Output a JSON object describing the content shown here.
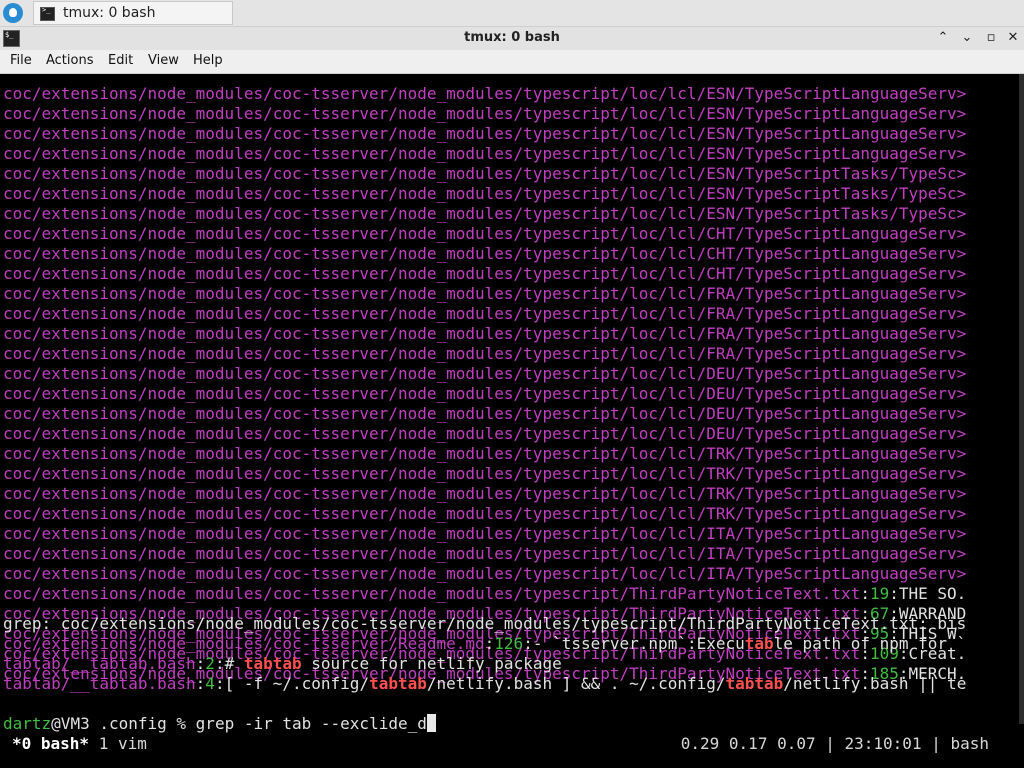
{
  "taskbar": {
    "task_label": "tmux: 0 bash"
  },
  "window": {
    "title": "tmux: 0 bash",
    "controls": {
      "collapse": "⌃",
      "minimize": "⌄",
      "maximize": "▫",
      "close": "✕"
    }
  },
  "menubar": {
    "items": [
      "File",
      "Actions",
      "Edit",
      "View",
      "Help"
    ]
  },
  "terminal": {
    "results": [
      {
        "path": "coc/extensions/node_modules/coc-tsserver/node_modules/typescript/loc/lcl/ESN/TypeScriptLanguageServ>"
      },
      {
        "path": "coc/extensions/node_modules/coc-tsserver/node_modules/typescript/loc/lcl/ESN/TypeScriptLanguageServ>"
      },
      {
        "path": "coc/extensions/node_modules/coc-tsserver/node_modules/typescript/loc/lcl/ESN/TypeScriptLanguageServ>"
      },
      {
        "path": "coc/extensions/node_modules/coc-tsserver/node_modules/typescript/loc/lcl/ESN/TypeScriptLanguageServ>"
      },
      {
        "path": "coc/extensions/node_modules/coc-tsserver/node_modules/typescript/loc/lcl/ESN/TypeScriptTasks/TypeSc>"
      },
      {
        "path": "coc/extensions/node_modules/coc-tsserver/node_modules/typescript/loc/lcl/ESN/TypeScriptTasks/TypeSc>"
      },
      {
        "path": "coc/extensions/node_modules/coc-tsserver/node_modules/typescript/loc/lcl/ESN/TypeScriptTasks/TypeSc>"
      },
      {
        "path": "coc/extensions/node_modules/coc-tsserver/node_modules/typescript/loc/lcl/CHT/TypeScriptLanguageServ>"
      },
      {
        "path": "coc/extensions/node_modules/coc-tsserver/node_modules/typescript/loc/lcl/CHT/TypeScriptLanguageServ>"
      },
      {
        "path": "coc/extensions/node_modules/coc-tsserver/node_modules/typescript/loc/lcl/CHT/TypeScriptLanguageServ>"
      },
      {
        "path": "coc/extensions/node_modules/coc-tsserver/node_modules/typescript/loc/lcl/FRA/TypeScriptLanguageServ>"
      },
      {
        "path": "coc/extensions/node_modules/coc-tsserver/node_modules/typescript/loc/lcl/FRA/TypeScriptLanguageServ>"
      },
      {
        "path": "coc/extensions/node_modules/coc-tsserver/node_modules/typescript/loc/lcl/FRA/TypeScriptLanguageServ>"
      },
      {
        "path": "coc/extensions/node_modules/coc-tsserver/node_modules/typescript/loc/lcl/FRA/TypeScriptLanguageServ>"
      },
      {
        "path": "coc/extensions/node_modules/coc-tsserver/node_modules/typescript/loc/lcl/DEU/TypeScriptLanguageServ>"
      },
      {
        "path": "coc/extensions/node_modules/coc-tsserver/node_modules/typescript/loc/lcl/DEU/TypeScriptLanguageServ>"
      },
      {
        "path": "coc/extensions/node_modules/coc-tsserver/node_modules/typescript/loc/lcl/DEU/TypeScriptLanguageServ>"
      },
      {
        "path": "coc/extensions/node_modules/coc-tsserver/node_modules/typescript/loc/lcl/DEU/TypeScriptLanguageServ>"
      },
      {
        "path": "coc/extensions/node_modules/coc-tsserver/node_modules/typescript/loc/lcl/TRK/TypeScriptLanguageServ>"
      },
      {
        "path": "coc/extensions/node_modules/coc-tsserver/node_modules/typescript/loc/lcl/TRK/TypeScriptLanguageServ>"
      },
      {
        "path": "coc/extensions/node_modules/coc-tsserver/node_modules/typescript/loc/lcl/TRK/TypeScriptLanguageServ>"
      },
      {
        "path": "coc/extensions/node_modules/coc-tsserver/node_modules/typescript/loc/lcl/TRK/TypeScriptLanguageServ>"
      },
      {
        "path": "coc/extensions/node_modules/coc-tsserver/node_modules/typescript/loc/lcl/ITA/TypeScriptLanguageServ>"
      },
      {
        "path": "coc/extensions/node_modules/coc-tsserver/node_modules/typescript/loc/lcl/ITA/TypeScriptLanguageServ>"
      },
      {
        "path": "coc/extensions/node_modules/coc-tsserver/node_modules/typescript/loc/lcl/ITA/TypeScriptLanguageServ>"
      },
      {
        "path": "coc/extensions/node_modules/coc-tsserver/node_modules/typescript/ThirdPartyNoticeText.txt",
        "lineno": "19",
        "text": "THE SO."
      },
      {
        "path": "coc/extensions/node_modules/coc-tsserver/node_modules/typescript/ThirdPartyNoticeText.txt",
        "lineno": "67",
        "text": "WARRAND"
      },
      {
        "path": "coc/extensions/node_modules/coc-tsserver/node_modules/typescript/ThirdPartyNoticeText.txt",
        "lineno": "95",
        "text": "THIS W"
      },
      {
        "path": "coc/extensions/node_modules/coc-tsserver/node_modules/typescript/ThirdPartyNoticeText.txt",
        "lineno": "109",
        "text": "Creat."
      },
      {
        "path": "coc/extensions/node_modules/coc-tsserver/node_modules/typescript/ThirdPartyNoticeText.txt",
        "lineno": "185",
        "text": "MERCH."
      }
    ],
    "grep_error": "grep: coc/extensions/node_modules/coc-tsserver/node_modules/typescript/ThirdPartyNoticeText.txt: bis",
    "readme": {
      "path": "coc/extensions/node_modules/coc-tsserver/Readme.md",
      "lineno": "126",
      "pre": "- `tsserver.npm`:Execu",
      "match": "tab",
      "post": "le path of npm for `"
    },
    "tabtab1": {
      "path": "tabtab/__tabtab.bash",
      "lineno": "2",
      "pre": "# ",
      "match": "tabtab",
      "post": " source for netlify package"
    },
    "tabtab2": {
      "path": "tabtab/__tabtab.bash",
      "lineno": "4",
      "pre": "[ -f ~/.config/",
      "match1": "tabtab",
      "mid": "/netlify.bash ] && . ~/.config/",
      "match2": "tabtab",
      "post": "/netlify.bash || te"
    },
    "prompt": {
      "user": "dartz",
      "host": "@VM3 .config % ",
      "command": "grep -ir tab --exclide_d"
    }
  },
  "tmux_status": {
    "windows": " *0 bash* 1 vim",
    "active_window": "*0 bash*",
    "other_window": "1 vim",
    "right": "0.29 0.17 0.07 | 23:10:01 | bash"
  },
  "colors": {
    "path": "#c13ec1",
    "lineno": "#3fbe3f",
    "match": "#ff5050",
    "text": "#e2e2e2"
  }
}
